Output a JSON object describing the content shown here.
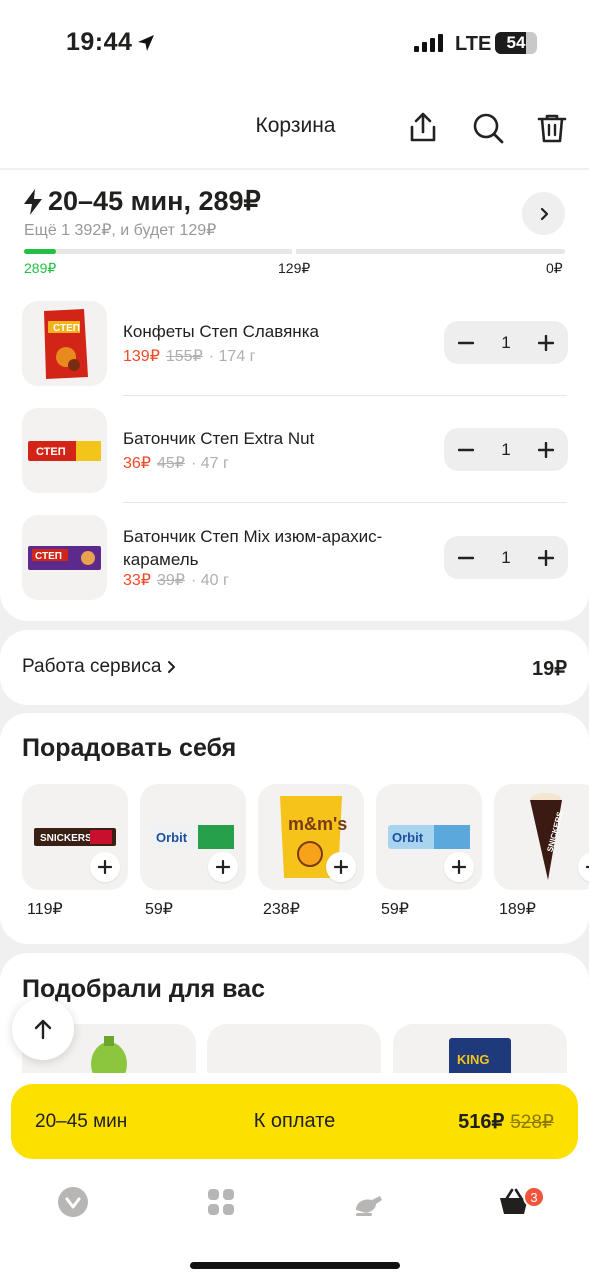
{
  "status_bar": {
    "time": "19:44",
    "network": "LTE",
    "battery": "54"
  },
  "header": {
    "title": "Корзина"
  },
  "delivery": {
    "title": "20–45 мин, 289₽",
    "subtitle": "Ещё 1 392₽, и будет 129₽",
    "progress_labels": [
      "289₽",
      "129₽",
      "0₽"
    ],
    "progress_fraction": 0.06,
    "colors": {
      "progress_active": "#21c043",
      "progress_rest": "#e7e7e7"
    }
  },
  "cart": {
    "items": [
      {
        "name": "Конфеты Степ Славянка",
        "price": "139₽",
        "old_price": "155₽",
        "weight": "· 174 г",
        "qty": "1"
      },
      {
        "name": "Батончик Степ Extra Nut",
        "price": "36₽",
        "old_price": "45₽",
        "weight": "· 47 г",
        "qty": "1"
      },
      {
        "name": "Батончик Степ Mix изюм-арахис-карамель",
        "price": "33₽",
        "old_price": "39₽",
        "weight": "· 40 г",
        "qty": "1"
      }
    ]
  },
  "service": {
    "label": "Работа сервиса",
    "price": "19₽"
  },
  "treat": {
    "title": "Порадовать себя",
    "products": [
      {
        "icon": "snickers-super-image",
        "price": "119₽"
      },
      {
        "icon": "orbit-white-image",
        "price": "59₽"
      },
      {
        "icon": "mms-peanut-image",
        "price": "238₽"
      },
      {
        "icon": "orbit-mint-image",
        "price": "59₽"
      },
      {
        "icon": "snickers-icecream-image",
        "price": "189₽"
      }
    ]
  },
  "recommended": {
    "title": "Подобрали для вас"
  },
  "checkout": {
    "time": "20–45 мин",
    "label": "К оплате",
    "total": "516₽",
    "old_total": "528₽",
    "accent": "#fce000"
  },
  "tabbar": {
    "cart_badge": "3"
  }
}
